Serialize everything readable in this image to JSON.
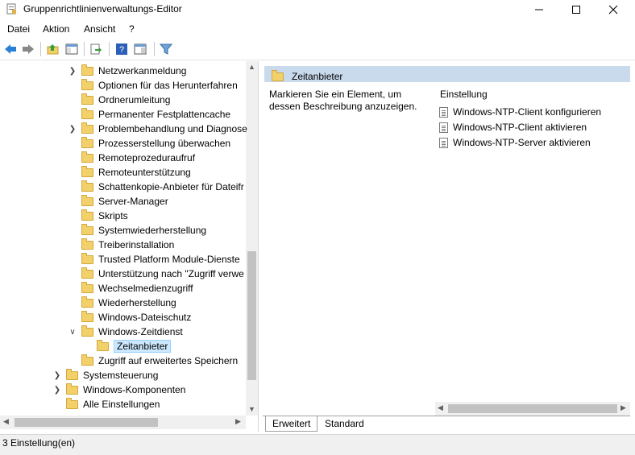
{
  "window": {
    "title": "Gruppenrichtlinienverwaltungs-Editor"
  },
  "menu": [
    "Datei",
    "Aktion",
    "Ansicht",
    "?"
  ],
  "toolbar": [
    "back-icon",
    "forward-icon",
    "up-folder-icon",
    "show-hide-tree-icon",
    "export-icon",
    "help-icon",
    "properties-icon",
    "filter-icon"
  ],
  "tree": [
    {
      "label": "Netzwerkanmeldung",
      "expander": ">"
    },
    {
      "label": "Optionen für das Herunterfahren",
      "expander": ""
    },
    {
      "label": "Ordnerumleitung",
      "expander": ""
    },
    {
      "label": "Permanenter Festplattencache",
      "expander": ""
    },
    {
      "label": "Problembehandlung und Diagnose",
      "expander": ">"
    },
    {
      "label": "Prozesserstellung überwachen",
      "expander": ""
    },
    {
      "label": "Remoteprozeduraufruf",
      "expander": ""
    },
    {
      "label": "Remoteunterstützung",
      "expander": ""
    },
    {
      "label": "Schattenkopie-Anbieter für Dateifr",
      "expander": ""
    },
    {
      "label": "Server-Manager",
      "expander": ""
    },
    {
      "label": "Skripts",
      "expander": ""
    },
    {
      "label": "Systemwiederherstellung",
      "expander": ""
    },
    {
      "label": "Treiberinstallation",
      "expander": ""
    },
    {
      "label": "Trusted Platform Module-Dienste",
      "expander": ""
    },
    {
      "label": "Unterstützung nach \"Zugriff verwe",
      "expander": ""
    },
    {
      "label": "Wechselmedienzugriff",
      "expander": ""
    },
    {
      "label": "Wiederherstellung",
      "expander": ""
    },
    {
      "label": "Windows-Dateischutz",
      "expander": ""
    },
    {
      "label": "Windows-Zeitdienst",
      "expander": "v"
    },
    {
      "label": "Zeitanbieter",
      "expander": ""
    },
    {
      "label": "Zugriff auf erweitertes Speichern",
      "expander": ""
    },
    {
      "label": "Systemsteuerung",
      "expander": ">"
    },
    {
      "label": "Windows-Komponenten",
      "expander": ">"
    },
    {
      "label": "Alle Einstellungen",
      "expander": ""
    }
  ],
  "right": {
    "header": "Zeitanbieter",
    "description": "Markieren Sie ein Element, um dessen Beschreibung anzuzeigen.",
    "column_header": "Einstellung",
    "settings": [
      "Windows-NTP-Client konfigurieren",
      "Windows-NTP-Client aktivieren",
      "Windows-NTP-Server aktivieren"
    ]
  },
  "tabs": [
    "Erweitert",
    "Standard"
  ],
  "status": "3 Einstellung(en)"
}
